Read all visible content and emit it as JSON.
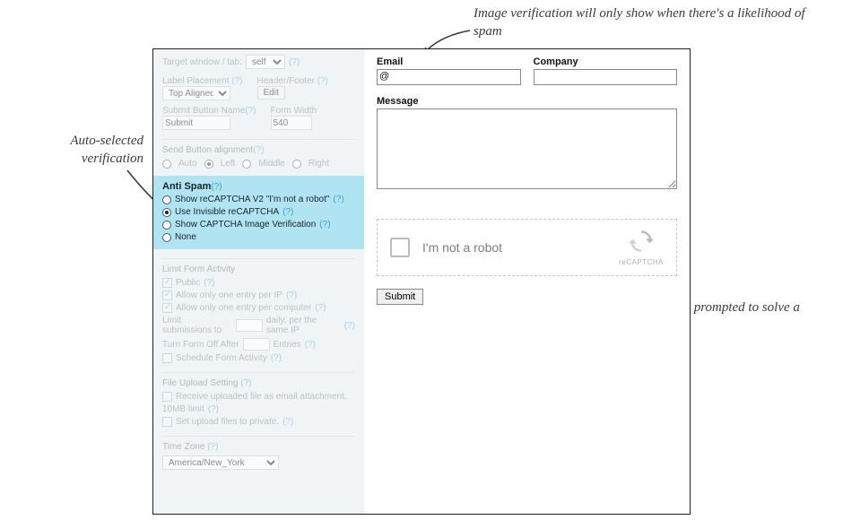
{
  "annotations": {
    "top": "Image verification will only show when there's a likelihood of spam",
    "left_line1": "Auto-selected",
    "left_line2": "verification",
    "bottom": "Only suspicious traffic will be prompted to solve a CAPTCHA"
  },
  "left_panel": {
    "target_window_label": "Target window / tab:",
    "target_window_value": "self",
    "label_placement_label": "Label Placement",
    "label_placement_value": "Top Aligned",
    "header_footer_label": "Header/Footer",
    "edit_btn": "Edit",
    "submit_name_label": "Submit Button Name",
    "submit_name_value": "Submit",
    "form_width_label": "Form Width",
    "form_width_value": "540",
    "send_align_label": "Send Button alignment",
    "align_opts": {
      "auto": "Auto",
      "left": "Left",
      "middle": "Middle",
      "right": "Right"
    },
    "antispam_title": "Anti Spam",
    "antispam_opts": {
      "v2": "Show reCAPTCHA V2 \"I'm not a robot\"",
      "invisible": "Use Invisible reCAPTCHA",
      "image": "Show CAPTCHA Image Verification",
      "none": "None"
    },
    "limit_title": "Limit Form Activity",
    "limit_public": "Public",
    "limit_ip": "Allow only one entry per IP",
    "limit_computer": "Allow only one entry per computer",
    "limit_sub_pre": "Limit submissions to",
    "limit_sub_post": "daily, per the same IP",
    "turn_off_pre": "Turn Form Off After",
    "turn_off_post": "Entries",
    "schedule": "Schedule Form Activity",
    "upload_title": "File Upload Setting",
    "upload_attach": "Receive uploaded file as email attachment.",
    "upload_limit": "10MB limit",
    "upload_private": "Set upload files to private.",
    "timezone_title": "Time Zone",
    "timezone_value": "America/New_York",
    "help": "(?)"
  },
  "right_panel": {
    "email_label": "Email",
    "company_label": "Company",
    "message_label": "Message",
    "at": "@",
    "captcha_text": "I'm not a robot",
    "captcha_badge": "reCAPTCHA",
    "submit": "Submit"
  }
}
